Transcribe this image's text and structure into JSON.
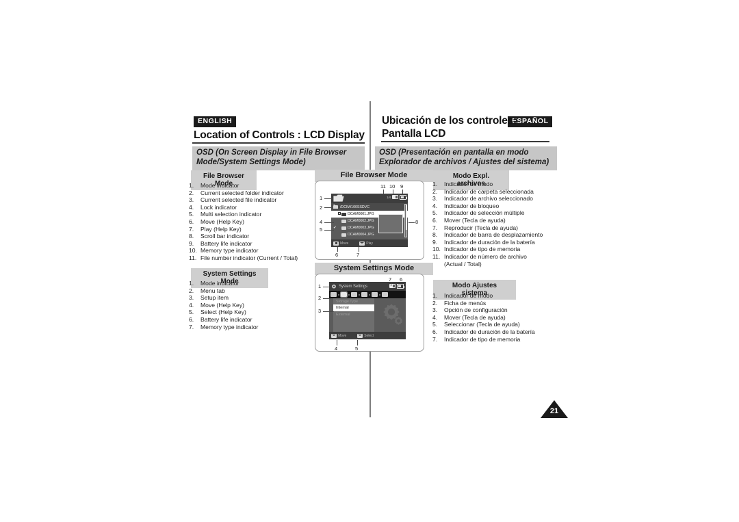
{
  "header": {
    "english_badge": "ENGLISH",
    "spanish_badge": "ESPAÑOL",
    "english_title": "Location of Controls : LCD Display",
    "spanish_title_line1": "Ubicación de los controles:",
    "spanish_title_line2": "Pantalla LCD",
    "english_subtitle": "OSD (On Screen Display in File Browser Mode/System Settings Mode)",
    "spanish_subtitle": "OSD (Presentación en pantalla en modo Explorador de archivos / Ajustes del sistema)"
  },
  "sections": {
    "file_browser_label_en": "File Browser Mode",
    "file_browser_label_center": "File Browser Mode",
    "file_browser_label_es": "Modo Expl. archivos",
    "system_settings_label_en": "System Settings Mode",
    "system_settings_label_center": "System Settings Mode",
    "system_settings_label_es": "Modo Ajustes sistema"
  },
  "file_browser_list_en": [
    {
      "num": "1.",
      "text": "Mode indicator"
    },
    {
      "num": "2.",
      "text": "Current selected folder indicator"
    },
    {
      "num": "3.",
      "text": "Current selected file indicator"
    },
    {
      "num": "4.",
      "text": "Lock indicator"
    },
    {
      "num": "5.",
      "text": "Multi selection indicator"
    },
    {
      "num": "6.",
      "text": "Move (Help Key)"
    },
    {
      "num": "7.",
      "text": "Play (Help Key)"
    },
    {
      "num": "8.",
      "text": "Scroll bar indicator"
    },
    {
      "num": "9.",
      "text": "Battery life indicator"
    },
    {
      "num": "10.",
      "text": "Memory type indicator"
    },
    {
      "num": "11.",
      "text": "File number indicator (Current / Total)"
    }
  ],
  "system_settings_list_en": [
    {
      "num": "1.",
      "text": "Mode indicator"
    },
    {
      "num": "2.",
      "text": "Menu tab"
    },
    {
      "num": "3.",
      "text": "Setup item"
    },
    {
      "num": "4.",
      "text": "Move (Help Key)"
    },
    {
      "num": "5.",
      "text": "Select (Help Key)"
    },
    {
      "num": "6.",
      "text": "Battery life indicator"
    },
    {
      "num": "7.",
      "text": "Memory type indicator"
    }
  ],
  "file_browser_list_es": [
    {
      "num": "1.",
      "text": "Indicador de modo"
    },
    {
      "num": "2.",
      "text": "Indicador de carpeta seleccionada"
    },
    {
      "num": "3.",
      "text": "Indicador de archivo seleccionado"
    },
    {
      "num": "4.",
      "text": "Indicador de bloqueo"
    },
    {
      "num": "5.",
      "text": "Indicador de selección múltiple"
    },
    {
      "num": "6.",
      "text": "Mover (Tecla de ayuda)"
    },
    {
      "num": "7.",
      "text": "Reproducir (Tecla de ayuda)"
    },
    {
      "num": "8.",
      "text": "Indicador de barra de desplazamiento"
    },
    {
      "num": "9.",
      "text": "Indicador de duración de la batería"
    },
    {
      "num": "10.",
      "text": "Indicador de tipo de memoria"
    },
    {
      "num": "11.",
      "text": "Indicador de número de archivo"
    }
  ],
  "file_browser_list_es_cont": "(Actual / Total)",
  "system_settings_list_es": [
    {
      "num": "1.",
      "text": "Indicador de modo"
    },
    {
      "num": "2.",
      "text": "Ficha de menús"
    },
    {
      "num": "3.",
      "text": "Opción de configuración"
    },
    {
      "num": "4.",
      "text": "Mover (Tecla de ayuda)"
    },
    {
      "num": "5.",
      "text": "Seleccionar (Tecla de ayuda)"
    },
    {
      "num": "6.",
      "text": "Indicador de duración de la batería"
    },
    {
      "num": "7.",
      "text": "Indicador de tipo de memoria"
    }
  ],
  "lcd_file_browser": {
    "file_count": "1/4",
    "path": "/DCIM/100SSDVC",
    "files": [
      {
        "name": "DCAM0001.JPG",
        "selected": true,
        "locked": true,
        "checked": false
      },
      {
        "name": "DCAM0002.JPG",
        "selected": false,
        "locked": false,
        "checked": false
      },
      {
        "name": "DCAM0003.JPG",
        "selected": false,
        "locked": false,
        "checked": true
      },
      {
        "name": "DCAM0004.JPG",
        "selected": false,
        "locked": false,
        "checked": false
      }
    ],
    "help_move": "Move",
    "help_play": "Play"
  },
  "lcd_system_settings": {
    "title": "System Settings",
    "menu_head": "Storage Type",
    "option_selected": "Internal",
    "option_other": "External",
    "help_move": "Move",
    "help_select": "Select"
  },
  "callouts": {
    "fb": [
      "1",
      "2",
      "4",
      "5",
      "6",
      "7",
      "8",
      "9",
      "10",
      "11"
    ],
    "ss": [
      "1",
      "2",
      "3",
      "4",
      "5",
      "6",
      "7"
    ]
  },
  "page_number": "21"
}
